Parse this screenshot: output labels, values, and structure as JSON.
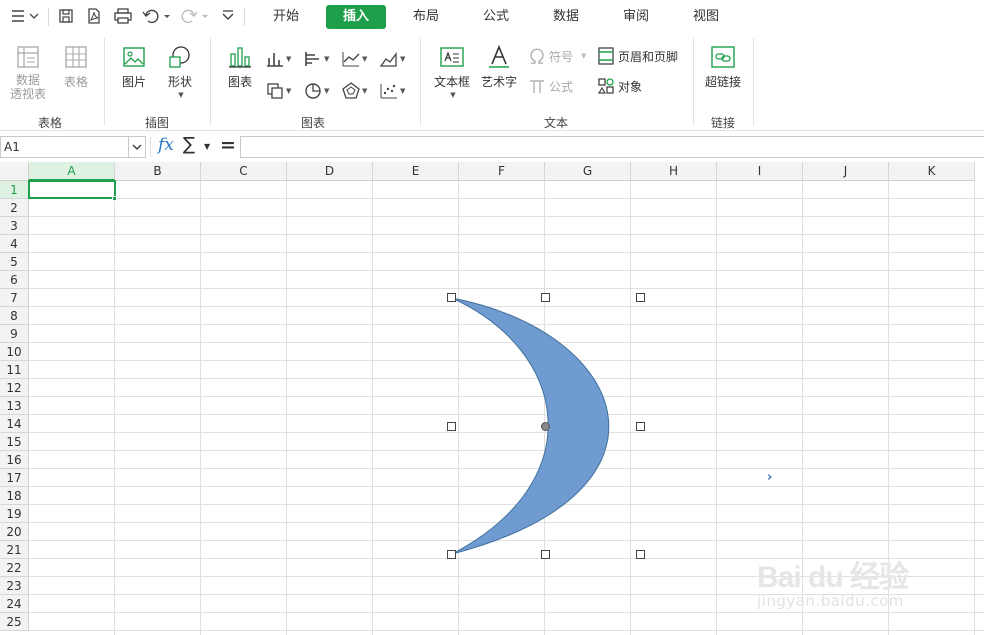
{
  "tabs": [
    {
      "label": "开始",
      "active": false
    },
    {
      "label": "插入",
      "active": true
    },
    {
      "label": "布局",
      "active": false
    },
    {
      "label": "公式",
      "active": false
    },
    {
      "label": "数据",
      "active": false
    },
    {
      "label": "审阅",
      "active": false
    },
    {
      "label": "视图",
      "active": false
    }
  ],
  "ribbon": {
    "groups": {
      "table": "表格",
      "illustration": "插图",
      "chart": "图表",
      "text": "文本",
      "link": "链接"
    },
    "buttons": {
      "pivot_line1": "数据",
      "pivot_line2": "透视表",
      "table": "表格",
      "picture": "图片",
      "shape": "形状",
      "chart": "图表",
      "textbox": "文本框",
      "wordart": "艺术字",
      "symbol": "符号",
      "equation": "公式",
      "header_footer": "页眉和页脚",
      "object": "对象",
      "hyperlink": "超链接"
    }
  },
  "formula_bar": {
    "cell_ref": "A1",
    "fx": "fx",
    "sum": "∑",
    "equals": "="
  },
  "columns": [
    "A",
    "B",
    "C",
    "D",
    "E",
    "F",
    "G",
    "H",
    "I",
    "J",
    "K"
  ],
  "rows": [
    "1",
    "2",
    "3",
    "4",
    "5",
    "6",
    "7",
    "8",
    "9",
    "10",
    "11",
    "12",
    "13",
    "14",
    "15",
    "16",
    "17",
    "18",
    "19",
    "20",
    "21",
    "22",
    "23",
    "24",
    "25"
  ],
  "selected_cell": {
    "column": "A",
    "row": "1"
  },
  "shape": {
    "type": "moon",
    "fill": "#6f9bd1",
    "stroke": "#41719c"
  },
  "colors": {
    "accent": "#1e9f4b"
  },
  "watermark": {
    "logo": "Bai du 经验",
    "url": "jingyan.baidu.com"
  },
  "stray_mark": "›"
}
